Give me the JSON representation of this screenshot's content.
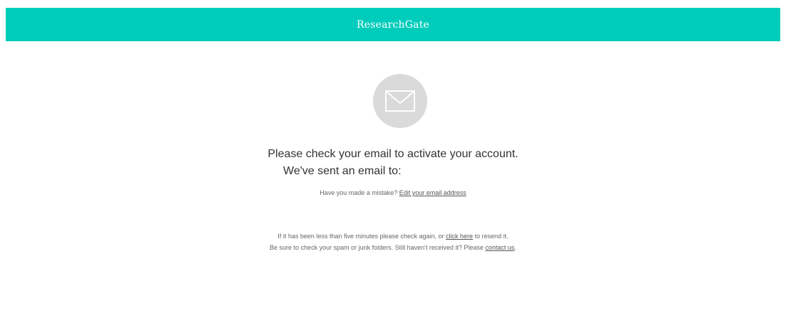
{
  "header": {
    "brand": "ResearchGate",
    "accent_color": "#00ccbb"
  },
  "icon": {
    "name": "envelope-icon",
    "background_color": "#dadada"
  },
  "message": {
    "line1": "Please check your email to activate your account.",
    "line2": "We've sent an email to:"
  },
  "mistake": {
    "prefix": "Have you made a mistake? ",
    "link": "Edit your email address"
  },
  "resend": {
    "prefix": "If it has been less than five minutes please check again, or ",
    "link": "click here",
    "suffix": " to resend it."
  },
  "spam": {
    "prefix": "Be sure to check your spam or junk folders. Still haven't received it? Please ",
    "link": "contact us",
    "suffix": "."
  }
}
